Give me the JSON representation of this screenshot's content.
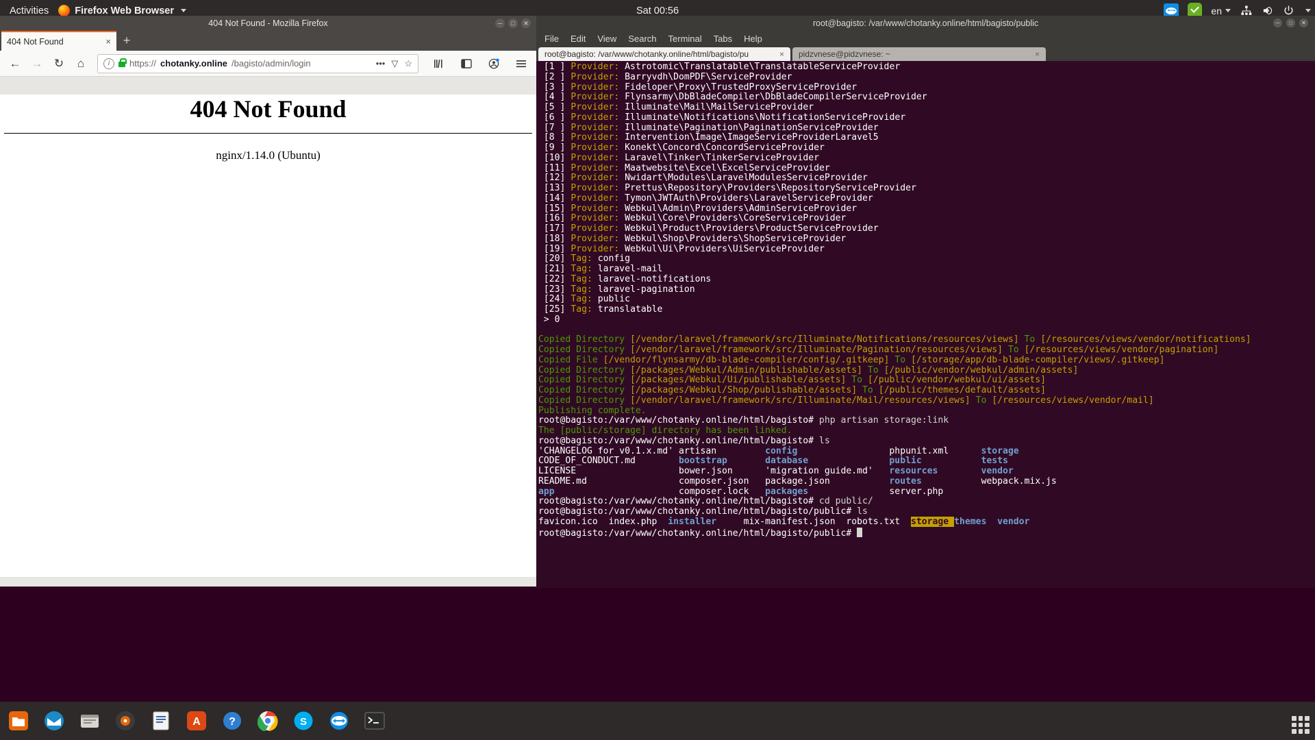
{
  "topbar": {
    "activities": "Activities",
    "app_name": "Firefox Web Browser",
    "clock": "Sat 00:56",
    "language": "en",
    "icons": [
      "teamviewer-icon",
      "shield-check-icon",
      "network-icon",
      "volume-icon",
      "power-icon"
    ]
  },
  "firefox": {
    "window_title": "404 Not Found - Mozilla Firefox",
    "tab_title": "404 Not Found",
    "tab_close": "×",
    "new_tab": "+",
    "nav": {
      "back": "←",
      "forward": "→",
      "reload": "↻",
      "home": "⌂"
    },
    "url": {
      "scheme": "https://",
      "host": "chotanky.online",
      "path": "/bagisto/admin/login",
      "full": "https://chotanky.online/bagisto/admin/login"
    },
    "url_actions": {
      "more": "•••",
      "reader": "▽",
      "bookmark": "☆"
    },
    "page": {
      "heading": "404 Not Found",
      "server": "nginx/1.14.0 (Ubuntu)"
    }
  },
  "terminal": {
    "window_title": "root@bagisto: /var/www/chotanky.online/html/bagisto/public",
    "menu": [
      "File",
      "Edit",
      "View",
      "Search",
      "Terminal",
      "Tabs",
      "Help"
    ],
    "tabs": [
      {
        "label": "root@bagisto: /var/www/chotanky.online/html/bagisto/pu",
        "close": "×",
        "active": true
      },
      {
        "label": "pidzvnese@pidzvnese: ~",
        "close": "×",
        "active": false
      }
    ],
    "providers": [
      {
        "index": "[1 ]",
        "label": "Provider:",
        "value": "Astrotomic\\Translatable\\TranslatableServiceProvider"
      },
      {
        "index": "[2 ]",
        "label": "Provider:",
        "value": "Barryvdh\\DomPDF\\ServiceProvider"
      },
      {
        "index": "[3 ]",
        "label": "Provider:",
        "value": "Fideloper\\Proxy\\TrustedProxyServiceProvider"
      },
      {
        "index": "[4 ]",
        "label": "Provider:",
        "value": "Flynsarmy\\DbBladeCompiler\\DbBladeCompilerServiceProvider"
      },
      {
        "index": "[5 ]",
        "label": "Provider:",
        "value": "Illuminate\\Mail\\MailServiceProvider"
      },
      {
        "index": "[6 ]",
        "label": "Provider:",
        "value": "Illuminate\\Notifications\\NotificationServiceProvider"
      },
      {
        "index": "[7 ]",
        "label": "Provider:",
        "value": "Illuminate\\Pagination\\PaginationServiceProvider"
      },
      {
        "index": "[8 ]",
        "label": "Provider:",
        "value": "Intervention\\Image\\ImageServiceProviderLaravel5"
      },
      {
        "index": "[9 ]",
        "label": "Provider:",
        "value": "Konekt\\Concord\\ConcordServiceProvider"
      },
      {
        "index": "[10]",
        "label": "Provider:",
        "value": "Laravel\\Tinker\\TinkerServiceProvider"
      },
      {
        "index": "[11]",
        "label": "Provider:",
        "value": "Maatwebsite\\Excel\\ExcelServiceProvider"
      },
      {
        "index": "[12]",
        "label": "Provider:",
        "value": "Nwidart\\Modules\\LaravelModulesServiceProvider"
      },
      {
        "index": "[13]",
        "label": "Provider:",
        "value": "Prettus\\Repository\\Providers\\RepositoryServiceProvider"
      },
      {
        "index": "[14]",
        "label": "Provider:",
        "value": "Tymon\\JWTAuth\\Providers\\LaravelServiceProvider"
      },
      {
        "index": "[15]",
        "label": "Provider:",
        "value": "Webkul\\Admin\\Providers\\AdminServiceProvider"
      },
      {
        "index": "[16]",
        "label": "Provider:",
        "value": "Webkul\\Core\\Providers\\CoreServiceProvider"
      },
      {
        "index": "[17]",
        "label": "Provider:",
        "value": "Webkul\\Product\\Providers\\ProductServiceProvider"
      },
      {
        "index": "[18]",
        "label": "Provider:",
        "value": "Webkul\\Shop\\Providers\\ShopServiceProvider"
      },
      {
        "index": "[19]",
        "label": "Provider:",
        "value": "Webkul\\Ui\\Providers\\UiServiceProvider"
      }
    ],
    "tags": [
      {
        "index": "[20]",
        "label": "Tag:",
        "value": "config"
      },
      {
        "index": "[21]",
        "label": "Tag:",
        "value": "laravel-mail"
      },
      {
        "index": "[22]",
        "label": "Tag:",
        "value": "laravel-notifications"
      },
      {
        "index": "[23]",
        "label": "Tag:",
        "value": "laravel-pagination"
      },
      {
        "index": "[24]",
        "label": "Tag:",
        "value": "public"
      },
      {
        "index": "[25]",
        "label": "Tag:",
        "value": "translatable"
      }
    ],
    "prompt_answer": "> 0",
    "copied": [
      {
        "action": "Copied Directory",
        "from": "[/vendor/laravel/framework/src/Illuminate/Notifications/resources/views]",
        "to_label": "To",
        "to": "[/resources/views/vendor/notifications]"
      },
      {
        "action": "Copied Directory",
        "from": "[/vendor/laravel/framework/src/Illuminate/Pagination/resources/views]",
        "to_label": "To",
        "to": "[/resources/views/vendor/pagination]"
      },
      {
        "action": "Copied File",
        "from": "[/vendor/flynsarmy/db-blade-compiler/config/.gitkeep]",
        "to_label": "To",
        "to": "[/storage/app/db-blade-compiler/views/.gitkeep]"
      },
      {
        "action": "Copied Directory",
        "from": "[/packages/Webkul/Admin/publishable/assets]",
        "to_label": "To",
        "to": "[/public/vendor/webkul/admin/assets]"
      },
      {
        "action": "Copied Directory",
        "from": "[/packages/Webkul/Ui/publishable/assets]",
        "to_label": "To",
        "to": "[/public/vendor/webkul/ui/assets]"
      },
      {
        "action": "Copied Directory",
        "from": "[/packages/Webkul/Shop/publishable/assets]",
        "to_label": "To",
        "to": "[/public/themes/default/assets]"
      },
      {
        "action": "Copied Directory",
        "from": "[/vendor/laravel/framework/src/Illuminate/Mail/resources/views]",
        "to_label": "To",
        "to": "[/resources/views/vendor/mail]"
      }
    ],
    "publishing_complete": "Publishing complete.",
    "prompt_bagisto": "root@bagisto:/var/www/chotanky.online/html/bagisto#",
    "prompt_public": "root@bagisto:/var/www/chotanky.online/html/bagisto/public#",
    "cmd_storage_link": " php artisan storage:link",
    "storage_linked_msg": "The [public/storage] directory has been linked.",
    "cmd_ls": " ls",
    "cmd_cd_public": " cd public/",
    "ls_bagisto_rows": [
      [
        {
          "t": "'CHANGELOG for v0.1.x.md'",
          "c": "white"
        },
        {
          "t": "artisan",
          "c": "white"
        },
        {
          "t": "config",
          "c": "blue"
        },
        {
          "t": "phpunit.xml",
          "c": "white"
        },
        {
          "t": "storage",
          "c": "blue"
        }
      ],
      [
        {
          "t": "CODE_OF_CONDUCT.md",
          "c": "white"
        },
        {
          "t": "bootstrap",
          "c": "blue"
        },
        {
          "t": "database",
          "c": "blue"
        },
        {
          "t": "public",
          "c": "blue"
        },
        {
          "t": "tests",
          "c": "blue"
        }
      ],
      [
        {
          "t": "LICENSE",
          "c": "white"
        },
        {
          "t": "bower.json",
          "c": "white"
        },
        {
          "t": "'migration guide.md'",
          "c": "white"
        },
        {
          "t": "resources",
          "c": "blue"
        },
        {
          "t": "vendor",
          "c": "blue"
        }
      ],
      [
        {
          "t": "README.md",
          "c": "white"
        },
        {
          "t": "composer.json",
          "c": "white"
        },
        {
          "t": "package.json",
          "c": "white"
        },
        {
          "t": "routes",
          "c": "blue"
        },
        {
          "t": "webpack.mix.js",
          "c": "white"
        }
      ],
      [
        {
          "t": "app",
          "c": "blue"
        },
        {
          "t": "composer.lock",
          "c": "white"
        },
        {
          "t": "packages",
          "c": "blue"
        },
        {
          "t": "server.php",
          "c": "white"
        },
        {
          "t": "",
          "c": "white"
        }
      ]
    ],
    "ls_public_row": [
      {
        "t": "favicon.ico",
        "c": "white"
      },
      {
        "t": "index.php",
        "c": "white"
      },
      {
        "t": "installer",
        "c": "blue"
      },
      {
        "t": "mix-manifest.json",
        "c": "white"
      },
      {
        "t": "robots.txt",
        "c": "white"
      },
      {
        "t": "storage",
        "c": "hl"
      },
      {
        "t": "themes",
        "c": "blue"
      },
      {
        "t": "vendor",
        "c": "blue"
      }
    ]
  },
  "dock": {
    "items": [
      {
        "name": "files-nautilus",
        "label": "",
        "color": "#e8670c"
      },
      {
        "name": "thunderbird",
        "label": "",
        "color": "#1b8ac7"
      },
      {
        "name": "file-manager",
        "label": "",
        "color": "#b5b0aa"
      },
      {
        "name": "rhythmbox",
        "label": "",
        "color": "#3b3b3b"
      },
      {
        "name": "libreoffice-writer",
        "label": "",
        "color": "#f0f0f0"
      },
      {
        "name": "ubuntu-software",
        "label": "A",
        "color": "#dd4814"
      },
      {
        "name": "help",
        "label": "?",
        "color": "#2f7fd1"
      },
      {
        "name": "google-chrome",
        "label": "",
        "color": "#f2f2f2"
      },
      {
        "name": "skype",
        "label": "S",
        "color": "#00aff0"
      },
      {
        "name": "teamviewer",
        "label": "",
        "color": "#0e8ee9"
      },
      {
        "name": "terminal",
        "label": "$",
        "color": "#2b2b2b"
      }
    ],
    "show_apps": "show-applications"
  },
  "colors": {
    "terminal_bg": "#300a24",
    "accent_orange": "#f06a23",
    "green": "#4e9a06",
    "yellow": "#c4a000",
    "blue": "#729fcf"
  }
}
